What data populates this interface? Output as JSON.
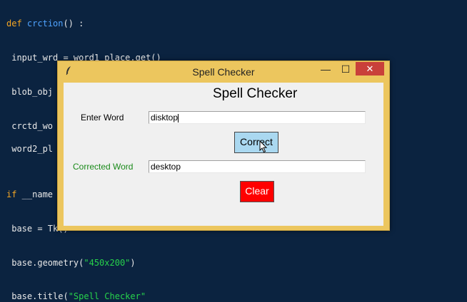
{
  "editor": {
    "line1_kw": "def",
    "line1_fn": "crction",
    "line1_rest": "() :",
    "line2": " input_wrd = word1_place.get()",
    "line3": " blob_obj",
    "line4": " crctd_wo",
    "line5": " word2_pl",
    "line6_kw": "if",
    "line6_rest": " __name",
    "line7": " base = Tk()",
    "line8_pre": " base.geometry(",
    "line8_str": "\"450x200\"",
    "line8_post": ")",
    "line9_pre": " base.title(",
    "line9_str": "\"Spell Checker\""
  },
  "window": {
    "title": "Spell Checker",
    "minimize_glyph": "—",
    "maximize_glyph": "☐",
    "close_glyph": "✕"
  },
  "app": {
    "heading": "Spell Checker",
    "enter_label": "Enter Word",
    "input_value": "disktop",
    "correct_button": "Correct",
    "corrected_label": "Corrected Word",
    "output_value": "desktop",
    "clear_button": "Clear"
  },
  "colors": {
    "editor_bg": "#0b2340",
    "window_frame": "#ecc65e",
    "correct_button_bg": "#aad8f0",
    "clear_button_bg": "#ff0000",
    "corrected_label": "#1a8a1a"
  }
}
